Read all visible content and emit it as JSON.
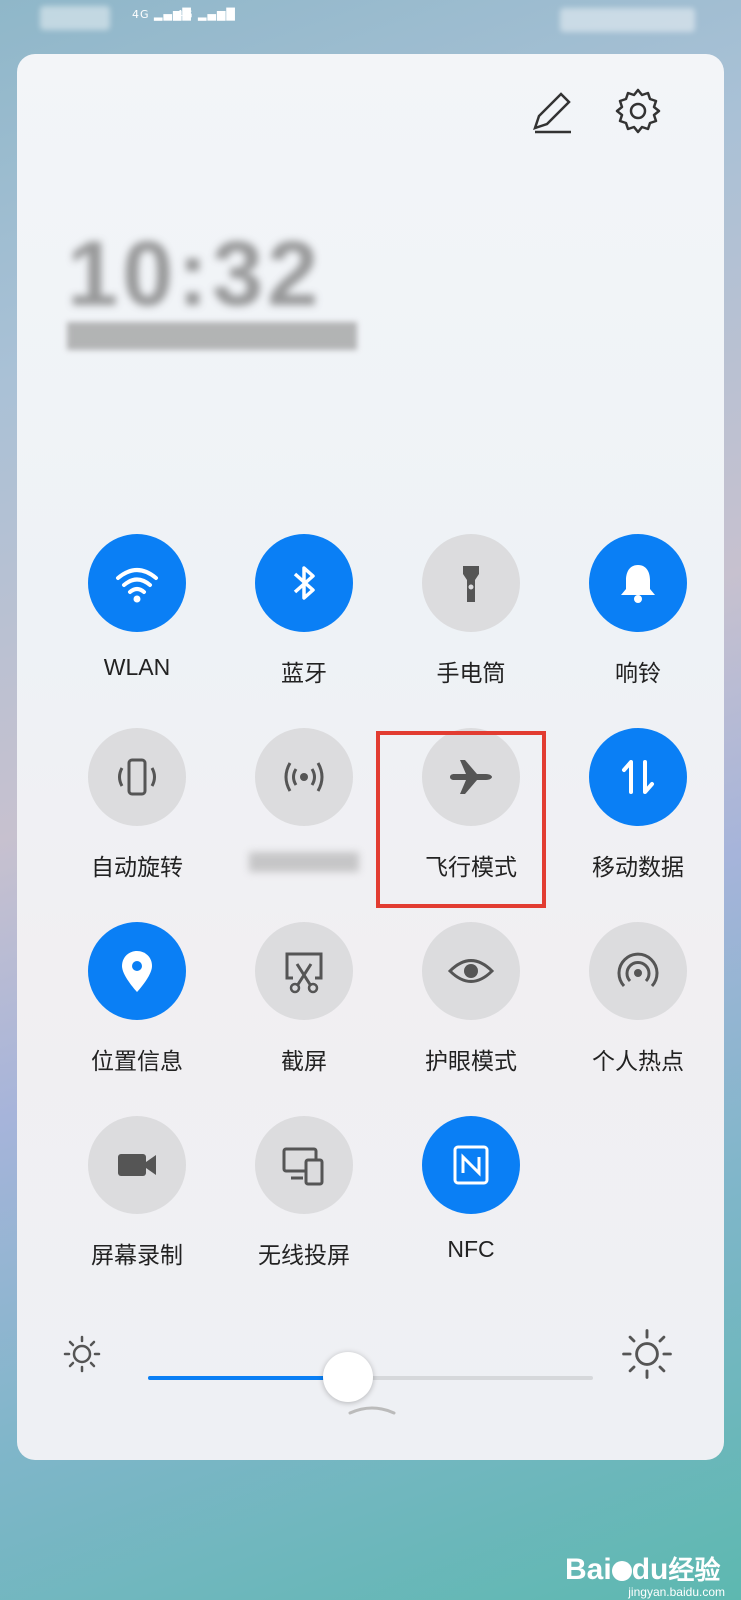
{
  "status_bar": {
    "sim1": "4G",
    "sim2": "4G"
  },
  "header": {
    "edit_icon": "pencil-icon",
    "settings_icon": "gear-icon"
  },
  "clock": {
    "time": "10:32",
    "date": ""
  },
  "tiles": [
    {
      "label": "WLAN",
      "icon": "wifi-icon",
      "active": true
    },
    {
      "label": "蓝牙",
      "icon": "bluetooth-icon",
      "active": true
    },
    {
      "label": "手电筒",
      "icon": "flashlight-icon",
      "active": false
    },
    {
      "label": "响铃",
      "icon": "bell-icon",
      "active": true
    },
    {
      "label": "自动旋转",
      "icon": "rotate-icon",
      "active": false
    },
    {
      "label": "",
      "icon": "broadcast-icon",
      "active": false
    },
    {
      "label": "飞行模式",
      "icon": "airplane-icon",
      "active": false,
      "highlighted": true
    },
    {
      "label": "移动数据",
      "icon": "mobile-data-icon",
      "active": true
    },
    {
      "label": "位置信息",
      "icon": "location-icon",
      "active": true
    },
    {
      "label": "截屏",
      "icon": "screenshot-icon",
      "active": false
    },
    {
      "label": "护眼模式",
      "icon": "eye-icon",
      "active": false
    },
    {
      "label": "个人热点",
      "icon": "hotspot-icon",
      "active": false
    },
    {
      "label": "屏幕录制",
      "icon": "video-icon",
      "active": false
    },
    {
      "label": "无线投屏",
      "icon": "cast-icon",
      "active": false
    },
    {
      "label": "NFC",
      "icon": "nfc-icon",
      "active": true
    }
  ],
  "brightness": {
    "level": 0.45
  },
  "watermark": {
    "brand": "Bai",
    "brand2": "du",
    "suffix": "经验",
    "url": "jingyan.baidu.com"
  },
  "colors": {
    "accent": "#0a7ff5",
    "inactive": "#dcdcde",
    "highlight": "#e23c31"
  }
}
